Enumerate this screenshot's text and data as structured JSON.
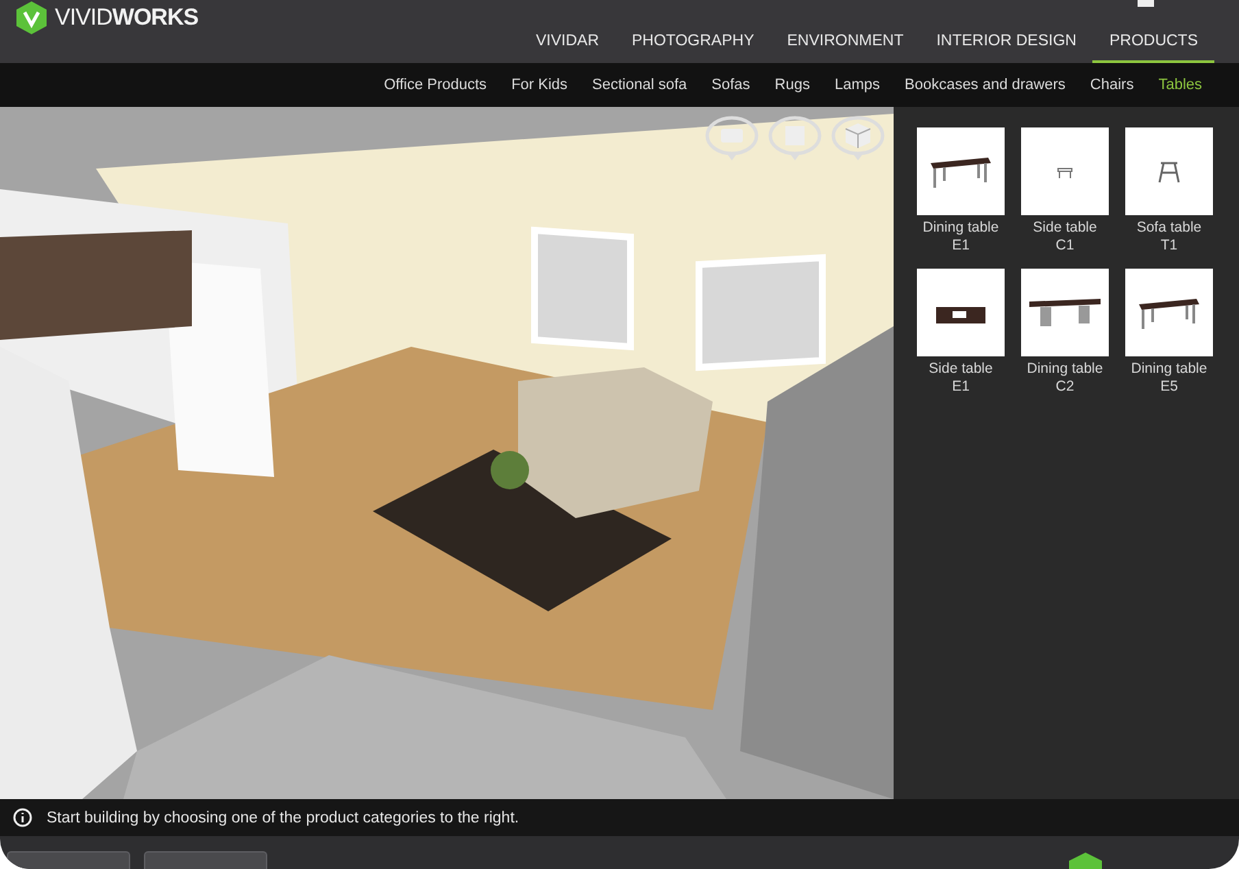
{
  "header": {
    "logo": {
      "light": "VIVID",
      "bold": "WORKS"
    },
    "nav": [
      {
        "label": "VIVIDAR",
        "selected": false
      },
      {
        "label": "PHOTOGRAPHY",
        "selected": false
      },
      {
        "label": "ENVIRONMENT",
        "selected": false
      },
      {
        "label": "INTERIOR DESIGN",
        "selected": false
      },
      {
        "label": "PRODUCTS",
        "selected": true
      }
    ]
  },
  "categories": [
    {
      "label": "Office Products",
      "selected": false
    },
    {
      "label": "For Kids",
      "selected": false
    },
    {
      "label": "Sectional sofa",
      "selected": false
    },
    {
      "label": "Sofas",
      "selected": false
    },
    {
      "label": "Rugs",
      "selected": false
    },
    {
      "label": "Lamps",
      "selected": false
    },
    {
      "label": "Bookcases and drawers",
      "selected": false
    },
    {
      "label": "Chairs",
      "selected": false
    },
    {
      "label": "Tables",
      "selected": true
    }
  ],
  "products": [
    {
      "name": "Dining table",
      "code": "E1",
      "kind": "long"
    },
    {
      "name": "Side table",
      "code": "C1",
      "kind": "small"
    },
    {
      "name": "Sofa table",
      "code": "T1",
      "kind": "stool"
    },
    {
      "name": "Side table",
      "code": "E1",
      "kind": "box"
    },
    {
      "name": "Dining table",
      "code": "C2",
      "kind": "slab"
    },
    {
      "name": "Dining table",
      "code": "E5",
      "kind": "long"
    }
  ],
  "status_bar": {
    "message": "Start building by choosing one of the product categories to the right."
  }
}
